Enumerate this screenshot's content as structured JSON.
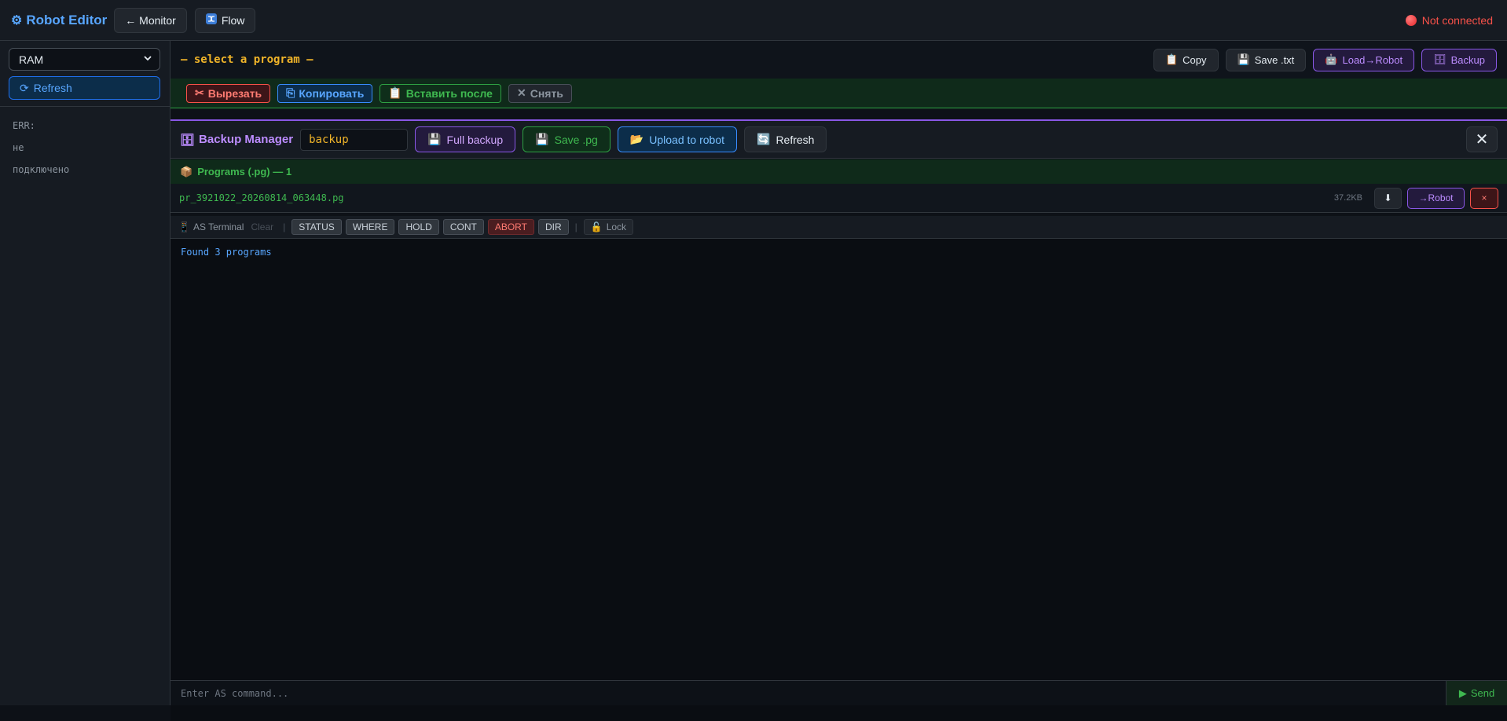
{
  "app": {
    "title": "Robot Editor",
    "nav": [
      {
        "label": "← Monitor"
      },
      {
        "label": "Flow"
      }
    ],
    "connection_status": "Not connected"
  },
  "sidebar": {
    "select_value": "RAM",
    "refresh_label": "Refresh",
    "err_lines": [
      "ERR:",
      "не",
      "подключено"
    ]
  },
  "program": {
    "title": "— select a program —"
  },
  "header_buttons": {
    "copy": "Copy",
    "save_txt": "Save .txt",
    "load_robot": "Load→Robot",
    "backup": "Backup"
  },
  "edit_buttons": {
    "cut": "Вырезать",
    "copy": "Копировать",
    "paste_after": "Вставить после",
    "deselect": "Снять"
  },
  "backup_manager": {
    "title": "Backup Manager",
    "name_value": "backup",
    "full_backup": "Full backup",
    "save_pg": "Save .pg",
    "upload": "Upload to robot",
    "refresh": "Refresh",
    "group_label": "Programs (.pg) — 1",
    "files": [
      {
        "name": "pr_3921022_20260814_063448.pg",
        "size": "37.2KB",
        "to_robot": "→Robot",
        "delete": "×"
      }
    ]
  },
  "terminal": {
    "title": "AS Terminal",
    "clear": "Clear",
    "commands": [
      "STATUS",
      "WHERE",
      "HOLD",
      "CONT",
      "ABORT",
      "DIR"
    ],
    "lock": "Lock",
    "output": "Found 3 programs",
    "input_placeholder": "Enter AS command...",
    "send": "Send"
  }
}
